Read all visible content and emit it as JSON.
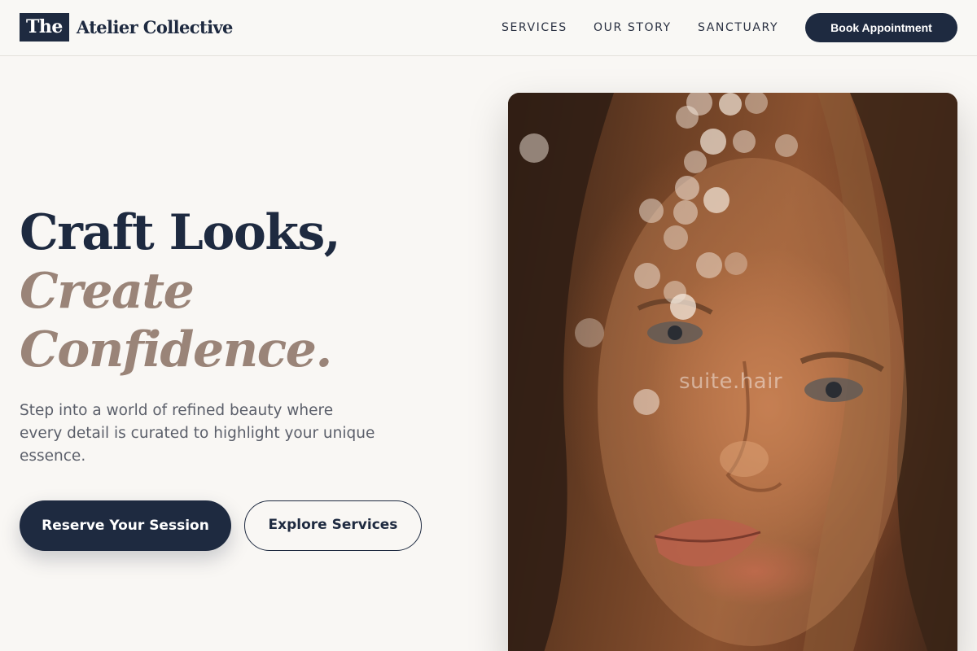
{
  "header": {
    "logo_mark": "The",
    "logo_text": "Atelier Collective",
    "nav": [
      {
        "label": "SERVICES"
      },
      {
        "label": "OUR STORY"
      },
      {
        "label": "SANCTUARY"
      }
    ],
    "cta_label": "Book Appointment"
  },
  "hero": {
    "title_line1": "Craft Looks,",
    "title_line2": "Create",
    "title_line3": "Confidence.",
    "subtitle": "Step into a world of refined beauty where every detail is curated to highlight your unique essence.",
    "primary_button": "Reserve Your Session",
    "secondary_button": "Explore Services"
  },
  "photo": {
    "watermark": "suite.hair",
    "icon": "portrait-photo"
  },
  "colors": {
    "navy": "#1e2a40",
    "taupe": "#9a8478",
    "background": "#f9f7f4"
  }
}
